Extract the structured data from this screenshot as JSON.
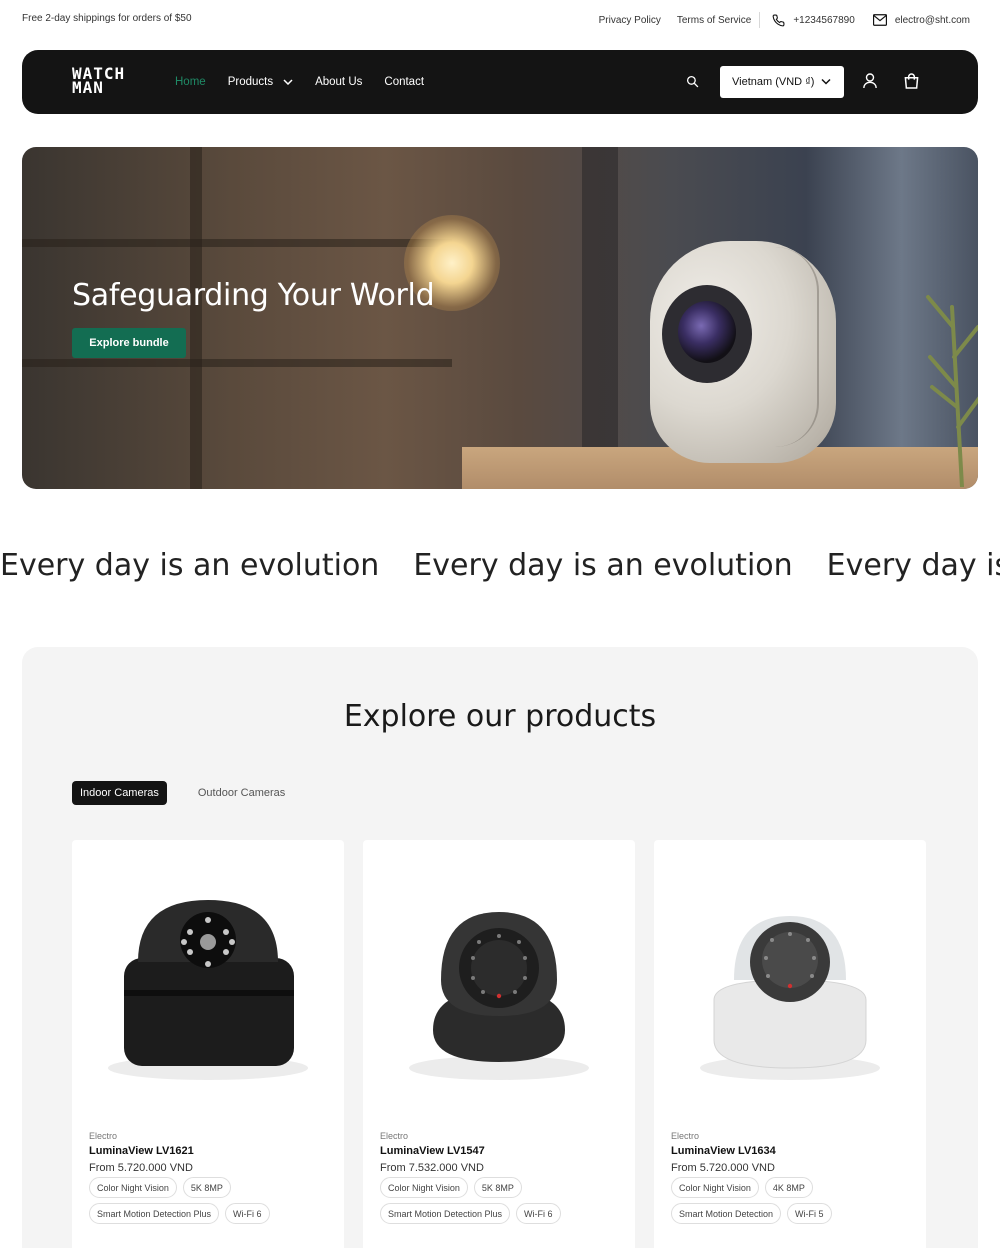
{
  "topbar": {
    "shipping": "Free 2-day shippings for orders of $50",
    "privacy": "Privacy Policy",
    "terms": "Terms of Service",
    "phone": "+1234567890",
    "email": "electro@sht.com"
  },
  "nav": {
    "logo_line1": "WATCH",
    "logo_line2": "MAN",
    "items": [
      {
        "label": "Home"
      },
      {
        "label": "Products"
      },
      {
        "label": "About Us"
      },
      {
        "label": "Contact"
      }
    ],
    "currency": "Vietnam (VND ₫)",
    "accent_color": "#1f8a66"
  },
  "hero": {
    "title": "Safeguarding Your World",
    "cta": "Explore bundle",
    "cta_color": "#136d52"
  },
  "marquee": {
    "items": [
      "Every day is an evolution",
      "Every day is an evolution",
      "Every day is"
    ]
  },
  "products": {
    "title": "Explore our products",
    "tabs": [
      {
        "label": "Indoor Cameras",
        "active": true
      },
      {
        "label": "Outdoor Cameras",
        "active": false
      }
    ],
    "cards": [
      {
        "brand": "Electro",
        "name": "LuminaView LV1621",
        "price": "From 5.720.000 VND",
        "tags": [
          "Color Night Vision",
          "5K 8MP",
          "Smart Motion Detection Plus",
          "Wi-Fi 6"
        ],
        "color": "black"
      },
      {
        "brand": "Electro",
        "name": "LuminaView LV1547",
        "price": "From 7.532.000 VND",
        "tags": [
          "Color Night Vision",
          "5K 8MP",
          "Smart Motion Detection Plus",
          "Wi-Fi 6"
        ],
        "color": "black"
      },
      {
        "brand": "Electro",
        "name": "LuminaView LV1634",
        "price": "From 5.720.000 VND",
        "tags": [
          "Color Night Vision",
          "4K 8MP",
          "Smart Motion Detection",
          "Wi-Fi 5"
        ],
        "color": "white"
      }
    ]
  }
}
